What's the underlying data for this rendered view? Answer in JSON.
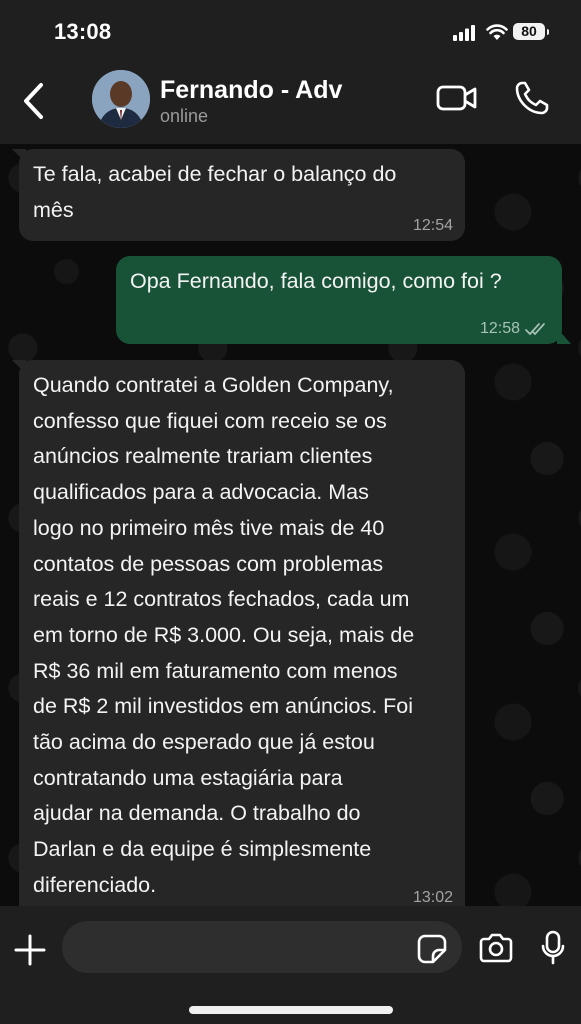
{
  "status_bar": {
    "time": "13:08",
    "battery": "80"
  },
  "header": {
    "contact_name": "Fernando - Adv",
    "contact_status": "online",
    "icons": [
      "back-chevron-icon",
      "video-call-icon",
      "phone-call-icon"
    ]
  },
  "messages": [
    {
      "direction": "incoming",
      "lines": [
        "Te fala, acabei de fechar o balanço do",
        "mês"
      ],
      "time": "12:54"
    },
    {
      "direction": "outgoing",
      "lines": [
        "Opa Fernando, fala comigo, como foi ?"
      ],
      "time": "12:58",
      "read": true
    },
    {
      "direction": "incoming",
      "lines": [
        "Quando contratei a Golden Company,",
        "confesso que fiquei com receio se os",
        "anúncios realmente trariam clientes",
        "qualificados para a advocacia. Mas",
        "logo no primeiro mês tive mais de 40",
        "contatos de pessoas com problemas",
        "reais e 12 contratos fechados, cada um",
        "em torno de R$ 3.000. Ou seja, mais de",
        "R$ 36 mil em faturamento com menos",
        "de R$ 2 mil investidos em anúncios. Foi",
        "tão acima do esperado que já estou",
        "contratando uma estagiária para",
        "ajudar na demanda. O trabalho do",
        "Darlan e da equipe é simplesmente",
        "diferenciado."
      ],
      "time": "13:02"
    }
  ],
  "composer": {
    "input_value": "",
    "icons": [
      "plus-icon",
      "sticker-icon",
      "camera-icon",
      "microphone-icon"
    ]
  },
  "colors": {
    "bar_background": "#1f1f1f",
    "incoming_bubble": "#262626",
    "outgoing_bubble": "#185337",
    "chat_background": "#0c0c0c"
  }
}
